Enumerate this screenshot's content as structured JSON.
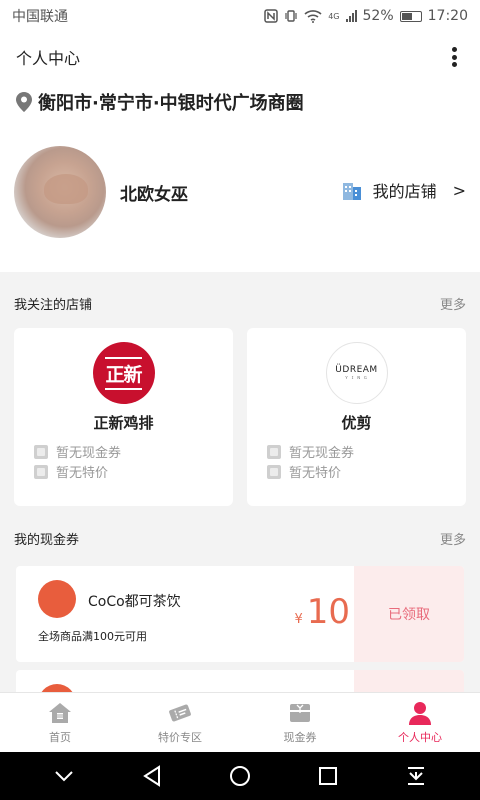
{
  "status_bar": {
    "carrier": "中国联通",
    "network": "4G",
    "battery": "52%",
    "time": "17:20"
  },
  "header": {
    "title": "个人中心",
    "more_icon": "more-vertical-icon"
  },
  "location": {
    "icon": "location-pin-icon",
    "text": "衡阳市·常宁市·中银时代广场商圈"
  },
  "profile": {
    "username": "北欧女巫",
    "my_shop_label": "我的店铺",
    "my_shop_arrow": ">"
  },
  "followed_stores": {
    "title": "我关注的店铺",
    "more": "更多",
    "items": [
      {
        "logo_text": "正新",
        "name": "正新鸡排",
        "coupon_status": "暂无现金券",
        "special_status": "暂无特价",
        "logo_color": "#c8102e"
      },
      {
        "logo_text": "ÜDREAM",
        "logo_subtext": "ʏ ɪ ɴ ɢ",
        "name": "优剪",
        "coupon_status": "暂无现金券",
        "special_status": "暂无特价",
        "logo_color": "#ffffff"
      }
    ]
  },
  "my_coupons": {
    "title": "我的现金券",
    "more": "更多",
    "items": [
      {
        "store": "CoCo都可茶饮",
        "condition": "全场商品满100元可用",
        "currency": "¥",
        "amount": "10",
        "status": "已领取"
      }
    ]
  },
  "tabbar": {
    "tabs": [
      {
        "label": "首页",
        "icon": "home-icon",
        "active": false
      },
      {
        "label": "特价专区",
        "icon": "ticket-icon",
        "active": false
      },
      {
        "label": "现金券",
        "icon": "coupon-box-icon",
        "active": false
      },
      {
        "label": "个人中心",
        "icon": "person-icon",
        "active": true
      }
    ]
  },
  "colors": {
    "accent": "#e8285a",
    "coupon_amount": "#e86b50",
    "coupon_claimed_bg": "#fcecec"
  }
}
